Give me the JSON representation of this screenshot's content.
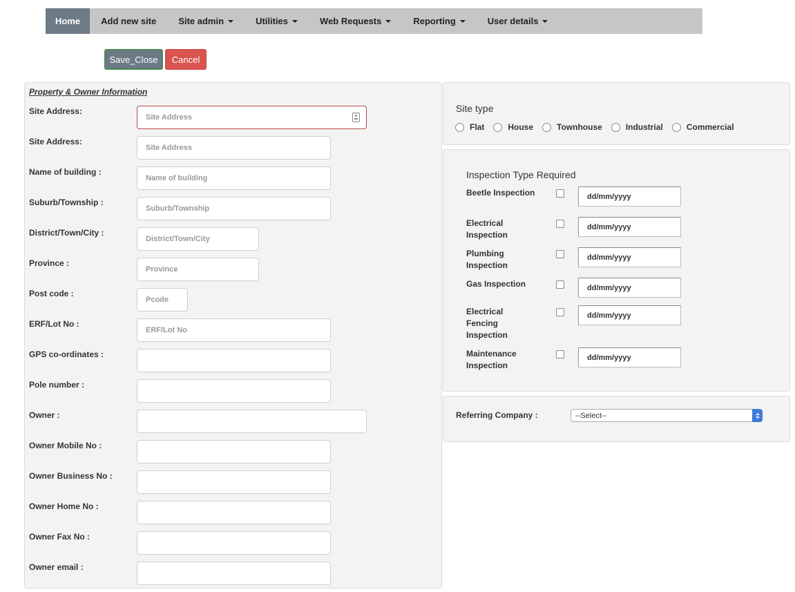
{
  "nav": {
    "items": [
      {
        "label": "Home",
        "active": true,
        "dropdown": false
      },
      {
        "label": "Add new site",
        "active": false,
        "dropdown": false
      },
      {
        "label": "Site admin",
        "active": false,
        "dropdown": true
      },
      {
        "label": "Utilities",
        "active": false,
        "dropdown": true
      },
      {
        "label": "Web Requests",
        "active": false,
        "dropdown": true
      },
      {
        "label": "Reporting",
        "active": false,
        "dropdown": true
      },
      {
        "label": "User details",
        "active": false,
        "dropdown": true
      }
    ]
  },
  "actions": {
    "save_label": "Save_Close",
    "cancel_label": "Cancel"
  },
  "property": {
    "section_title": "Property & Owner Information",
    "fields": [
      {
        "label": "Site Address:",
        "placeholder": "Site Address",
        "value": ""
      },
      {
        "label": "Site Address:",
        "placeholder": "Site Address",
        "value": ""
      },
      {
        "label": "Name of building :",
        "placeholder": "Name of building",
        "value": ""
      },
      {
        "label": "Suburb/Township :",
        "placeholder": "Suburb/Township",
        "value": ""
      },
      {
        "label": "District/Town/City :",
        "placeholder": "District/Town/City",
        "value": ""
      },
      {
        "label": "Province :",
        "placeholder": "Province",
        "value": ""
      },
      {
        "label": "Post code :",
        "placeholder": "Pcode",
        "value": ""
      },
      {
        "label": "ERF/Lot No :",
        "placeholder": "ERF/Lot No",
        "value": ""
      },
      {
        "label": "GPS co-ordinates :",
        "placeholder": "",
        "value": ""
      },
      {
        "label": "Pole number :",
        "placeholder": "",
        "value": ""
      },
      {
        "label": "Owner :",
        "placeholder": "",
        "value": ""
      },
      {
        "label": "Owner Mobile No :",
        "placeholder": "",
        "value": ""
      },
      {
        "label": "Owner Business No :",
        "placeholder": "",
        "value": ""
      },
      {
        "label": "Owner Home No :",
        "placeholder": "",
        "value": ""
      },
      {
        "label": "Owner Fax No :",
        "placeholder": "",
        "value": ""
      },
      {
        "label": "Owner email :",
        "placeholder": "",
        "value": ""
      }
    ]
  },
  "site_type": {
    "title": "Site type",
    "options": [
      "Flat",
      "House",
      "Townhouse",
      "Industrial",
      "Commercial"
    ]
  },
  "inspection": {
    "title": "Inspection Type Required",
    "items": [
      {
        "label": "Beetle Inspection",
        "checked": false,
        "date_placeholder": "dd/mm/yyyy"
      },
      {
        "label": "Electrical Inspection",
        "checked": false,
        "date_placeholder": "dd/mm/yyyy"
      },
      {
        "label": "Plumbing Inspection",
        "checked": false,
        "date_placeholder": "dd/mm/yyyy"
      },
      {
        "label": "Gas Inspection",
        "checked": false,
        "date_placeholder": "dd/mm/yyyy"
      },
      {
        "label": "Electrical Fencing Inspection",
        "checked": false,
        "date_placeholder": "dd/mm/yyyy"
      },
      {
        "label": "Maintenance Inspection",
        "checked": false,
        "date_placeholder": "dd/mm/yyyy"
      }
    ]
  },
  "referring": {
    "label": "Referring Company :",
    "selected": "--Select--"
  },
  "colors": {
    "nav_bg": "#c8c6c4",
    "nav_active": "#6d7b86",
    "save_button": "#6b7a85",
    "cancel_button": "#d9534f",
    "panel_bg": "#f3f3f3",
    "select_accent": "#3d7cd6"
  }
}
